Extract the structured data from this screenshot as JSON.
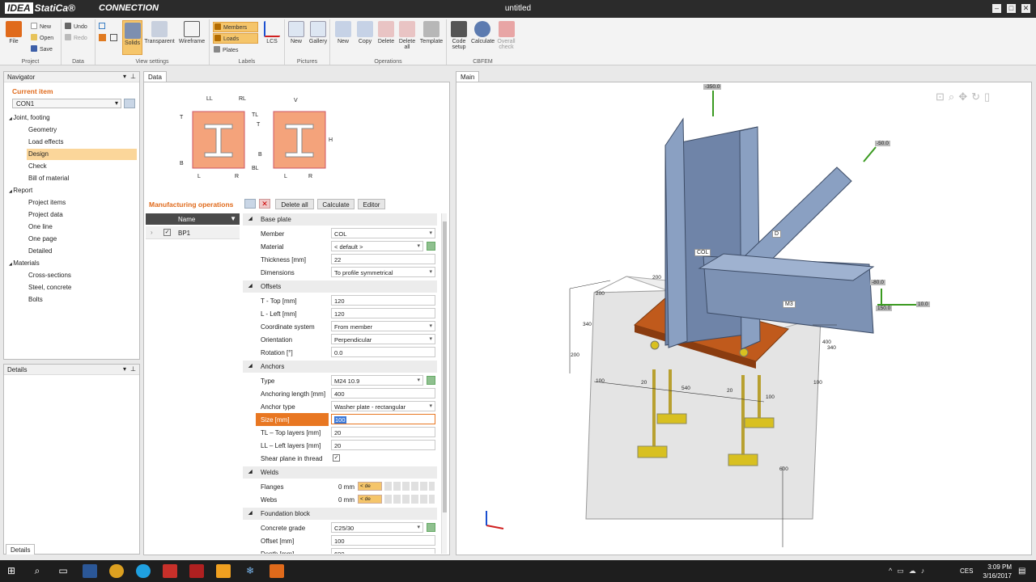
{
  "app": {
    "brand": "IDEA StatiCa",
    "module": "CONNECTION",
    "title": "untitled"
  },
  "ribbon": {
    "project": {
      "label": "Project",
      "file": "File",
      "new": "New",
      "open": "Open",
      "save": "Save"
    },
    "data": {
      "label": "Data",
      "undo": "Undo",
      "redo": "Redo"
    },
    "view": {
      "label": "View settings",
      "solids": "Solids",
      "transparent": "Transparent",
      "wireframe": "Wireframe"
    },
    "labels": {
      "label": "Labels",
      "members": "Members",
      "loads": "Loads",
      "plates": "Plates",
      "lcs": "LCS"
    },
    "pictures": {
      "label": "Pictures",
      "new": "New",
      "gallery": "Gallery"
    },
    "operations": {
      "label": "Operations",
      "new": "New",
      "copy": "Copy",
      "delete": "Delete",
      "delete_all": "Delete all",
      "template": "Template"
    },
    "cbfem": {
      "label": "CBFEM",
      "code_setup": "Code setup",
      "calculate": "Calculate",
      "overall_check": "Overall check"
    }
  },
  "navigator": {
    "title": "Navigator",
    "current_item": "Current item",
    "current_value": "CON1",
    "groups": [
      {
        "label": "Joint, footing",
        "items": [
          "Geometry",
          "Load effects",
          "Design",
          "Check",
          "Bill of material"
        ]
      },
      {
        "label": "Report",
        "items": [
          "Project items",
          "Project data",
          "One line",
          "One page",
          "Detailed"
        ]
      },
      {
        "label": "Materials",
        "items": [
          "Cross-sections",
          "Steel, concrete",
          "Bolts"
        ]
      }
    ],
    "selected": "Design"
  },
  "details": {
    "title": "Details",
    "tab": "Details"
  },
  "data_panel": {
    "tab": "Data",
    "diagram": {
      "ll": "LL",
      "rl": "RL",
      "t": "T",
      "b": "B",
      "l": "L",
      "r": "R",
      "tl": "TL",
      "bl": "BL",
      "v": "V",
      "h": "H"
    },
    "mfg": {
      "title": "Manufacturing operations",
      "delete_all": "Delete all",
      "calculate": "Calculate",
      "editor": "Editor",
      "col_name": "Name",
      "row": "BP1"
    },
    "sections": {
      "base_plate": {
        "title": "Base plate",
        "rows": [
          {
            "label": "Member",
            "value": "COL",
            "dd": true
          },
          {
            "label": "Material",
            "value": "< default >",
            "dd": true
          },
          {
            "label": "Thickness [mm]",
            "value": "22"
          },
          {
            "label": "Dimensions",
            "value": "To profile symmetrical",
            "dd": true
          }
        ]
      },
      "offsets": {
        "title": "Offsets",
        "rows": [
          {
            "label": "T - Top [mm]",
            "value": "120"
          },
          {
            "label": "L - Left [mm]",
            "value": "120"
          },
          {
            "label": "Coordinate system",
            "value": "From member",
            "dd": true
          },
          {
            "label": "Orientation",
            "value": "Perpendicular",
            "dd": true
          },
          {
            "label": "Rotation [°]",
            "value": "0.0"
          }
        ]
      },
      "anchors": {
        "title": "Anchors",
        "rows": [
          {
            "label": "Type",
            "value": "M24 10.9",
            "dd": true
          },
          {
            "label": "Anchoring length [mm]",
            "value": "400"
          },
          {
            "label": "Anchor type",
            "value": "Washer plate - rectangular",
            "dd": true
          },
          {
            "label": "Size [mm]",
            "value": "100"
          },
          {
            "label": "TL – Top layers [mm]",
            "value": "20"
          },
          {
            "label": "LL – Left layers [mm]",
            "value": "20"
          },
          {
            "label": "Shear plane in thread",
            "value": "✓"
          }
        ]
      },
      "welds": {
        "title": "Welds",
        "rows": [
          {
            "label": "Flanges",
            "value": "0 mm",
            "sel": "< de"
          },
          {
            "label": "Webs",
            "value": "0 mm",
            "sel": "< de"
          }
        ]
      },
      "foundation": {
        "title": "Foundation block",
        "rows": [
          {
            "label": "Concrete grade",
            "value": "C25/30",
            "dd": true
          },
          {
            "label": "Offset [mm]",
            "value": "100"
          },
          {
            "label": "Depth [mm]",
            "value": "600"
          }
        ]
      }
    }
  },
  "main": {
    "tab": "Main",
    "labels": {
      "col": "COL",
      "d": "D",
      "m3": "M3"
    },
    "loads": {
      "top": "-350.0",
      "brace": "-50.0",
      "r1": "-80.0",
      "r2": "150.0",
      "r3": "10.0"
    },
    "dims": {
      "d200a": "200",
      "d200b": "200",
      "d200c": "200",
      "d340": "340",
      "d100a": "100",
      "d100b": "100",
      "d100c": "100",
      "d20a": "20",
      "d20b": "20",
      "d540": "540",
      "d400": "400",
      "d340b": "340",
      "d600": "600"
    }
  },
  "taskbar": {
    "lang": "CES",
    "time": "3:09 PM",
    "date": "3/16/2017"
  }
}
